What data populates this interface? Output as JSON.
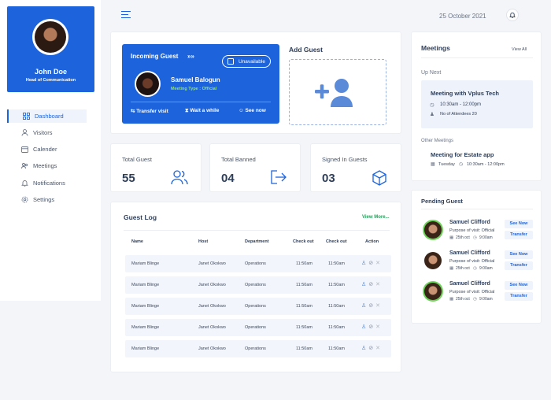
{
  "profile": {
    "name": "John Doe",
    "role": "Head of Communication"
  },
  "nav": [
    {
      "label": "Dashboard",
      "icon": "grid-icon",
      "active": true
    },
    {
      "label": "Visitors",
      "icon": "user-icon"
    },
    {
      "label": "Calender",
      "icon": "calendar-icon"
    },
    {
      "label": "Meetings",
      "icon": "meetings-icon"
    },
    {
      "label": "Notifications",
      "icon": "bell-icon"
    },
    {
      "label": "Settings",
      "icon": "gear-icon"
    }
  ],
  "topbar": {
    "date": "25 October 2021"
  },
  "incoming": {
    "title": "Incoming Guest",
    "arrows": "»»",
    "status_toggle": "Unavailable",
    "guest_name": "Samuel Balogun",
    "meeting_type": "Meeting Type : Official",
    "actions": [
      "Transfer visit",
      "Wait a while",
      "See now"
    ]
  },
  "add_guest": {
    "title": "Add Guest"
  },
  "stats": [
    {
      "label": "Total Guest",
      "value": "55",
      "icon": "users-icon"
    },
    {
      "label": "Total Banned",
      "value": "04",
      "icon": "exit-icon"
    },
    {
      "label": "Signed In Guests",
      "value": "03",
      "icon": "box-icon"
    }
  ],
  "guest_log": {
    "title": "Guest Log",
    "view_more": "View More...",
    "columns": [
      "Name",
      "Host",
      "Department",
      "Check out",
      "Check out",
      "Action"
    ],
    "rows": [
      [
        "Mariam Blinge",
        "Janet Okokwo",
        "Operations",
        "11:50am",
        "11:50am"
      ],
      [
        "Mariam Blinge",
        "Janet Okokwo",
        "Operations",
        "11:50am",
        "11:50am"
      ],
      [
        "Mariam Blinge",
        "Janet Okokwo",
        "Operations",
        "11:50am",
        "11:50am"
      ],
      [
        "Mariam Blinge",
        "Janet Okokwo",
        "Operations",
        "11:50am",
        "11:50am"
      ],
      [
        "Mariam Blinge",
        "Janet Okokwo",
        "Operations",
        "11:50am",
        "11:50am"
      ]
    ]
  },
  "meetings": {
    "title": "Meetings",
    "view_all": "View All",
    "up_next_label": "Up Next",
    "next": {
      "title": "Meeting with  Vplus Tech",
      "time": "10:30am - 12:00pm",
      "attendees": "No of Attendees  20"
    },
    "other_label": "Other Meetings",
    "other": {
      "title": "Meeting for Estate app",
      "day": "Tuesday",
      "time": "10:30am - 12:00pm"
    }
  },
  "pending": {
    "title": "Pending Guest",
    "items": [
      {
        "name": "Samuel Clifford",
        "purpose": "Purpose of visit: Official",
        "date": "25th oct",
        "time": "9:00am",
        "see_now": "See Now",
        "transfer": "Transfer"
      },
      {
        "name": "Samuel Clifford",
        "purpose": "Purpose of visit: Official",
        "date": "25th oct",
        "time": "9:00am",
        "see_now": "See Now",
        "transfer": "Transfer"
      },
      {
        "name": "Samuel Clifford",
        "purpose": "Purpose of visit: Official",
        "date": "25th oct",
        "time": "9:00am",
        "see_now": "See Now",
        "transfer": "Transfer"
      }
    ]
  },
  "colors": {
    "primary": "#1d63dc",
    "success": "#22a35a",
    "background": "#f4f5f9"
  }
}
